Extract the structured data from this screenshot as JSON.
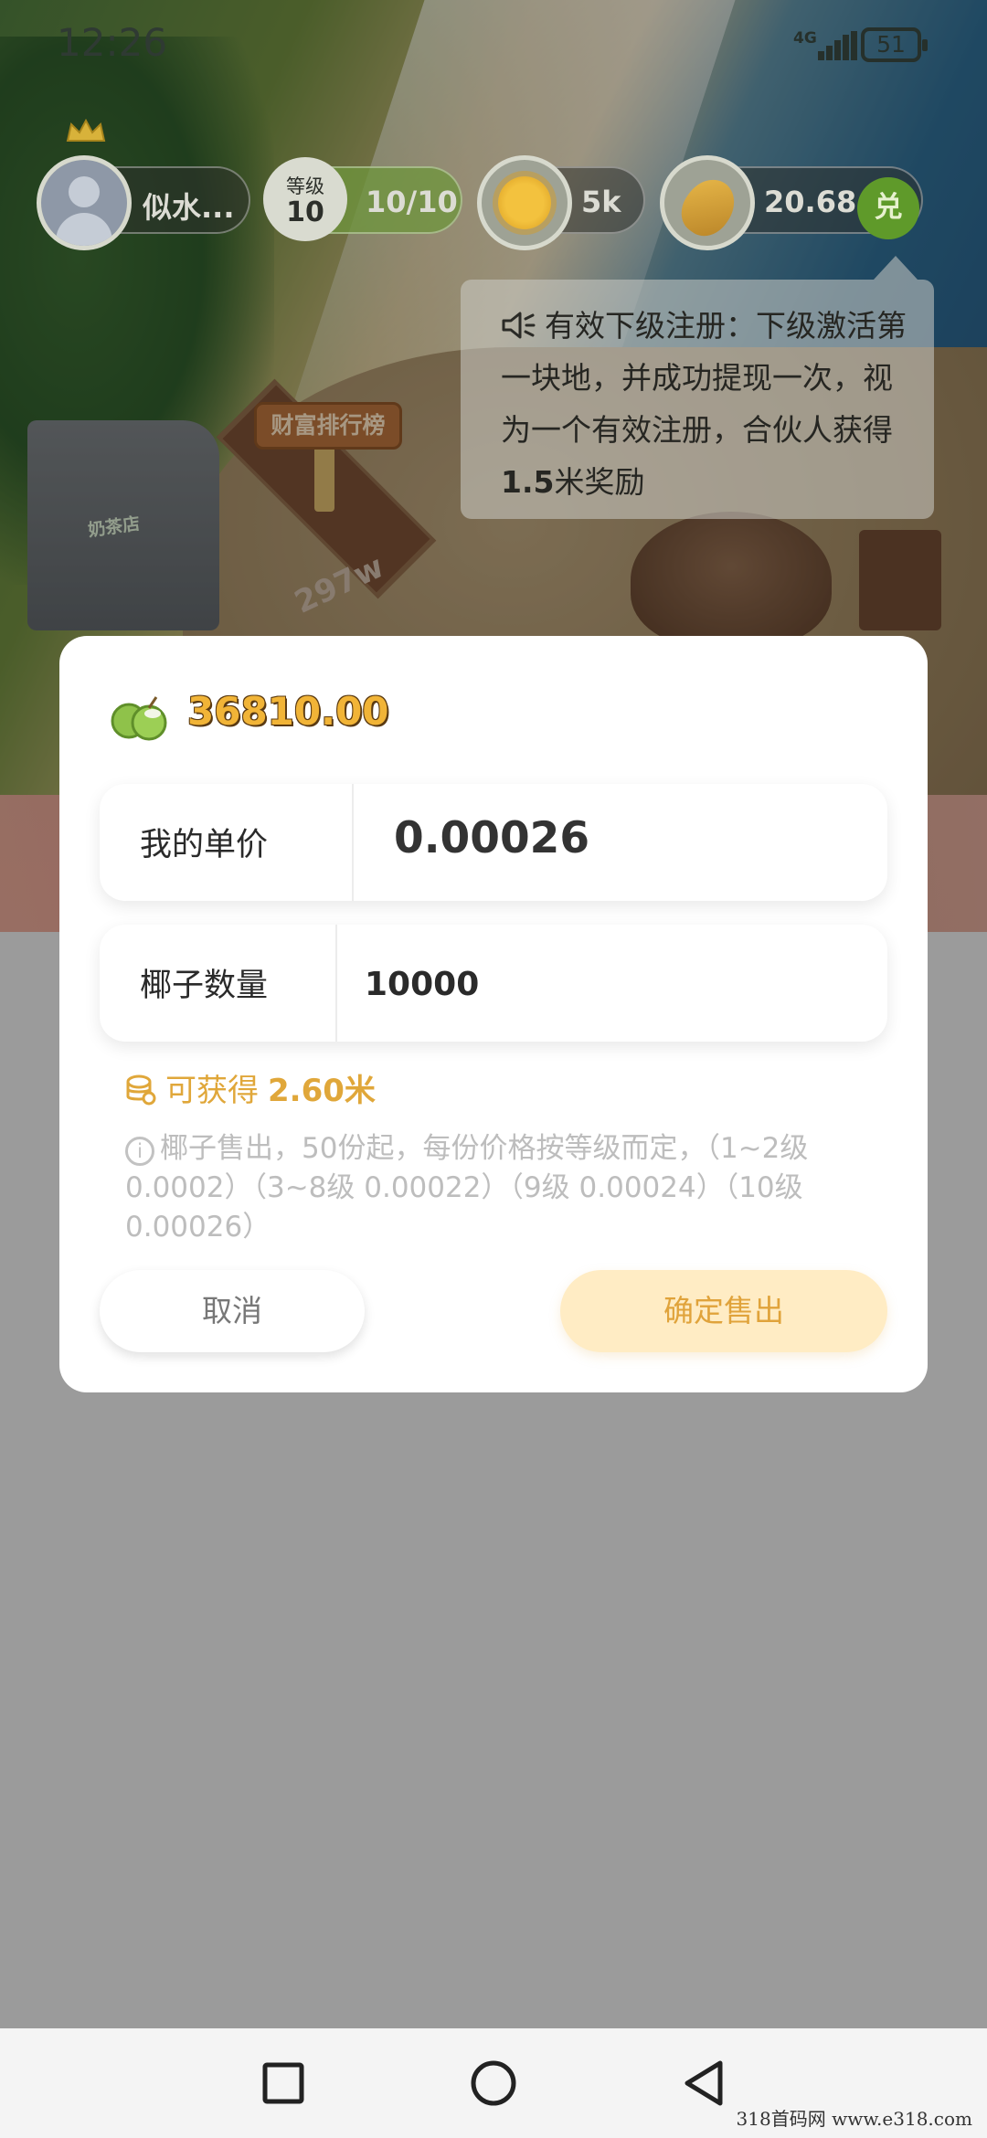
{
  "status_bar": {
    "time": "12:26",
    "network": "4G",
    "battery": "51"
  },
  "hud": {
    "username": "似水...",
    "level_label": "等级",
    "level_value": "10",
    "level_progress": "10/10",
    "sun_count": "5k",
    "corn_amount": "20.68",
    "exchange_label": "兑"
  },
  "game_scene": {
    "rank_sign": "财富排行榜",
    "building_label": "奶茶店",
    "path_label": "297w"
  },
  "notice": {
    "icon": "speaker-icon",
    "text_before": "有效下级注册：下级激活第一块地，并成功提现一次，视为一个有效注册，合伙人获得",
    "text_bold": "1.5",
    "text_after": "米奖励"
  },
  "dialog": {
    "coin_amount": "36810.00",
    "price_label": "我的单价",
    "price_value": "0.00026",
    "quantity_label": "椰子数量",
    "quantity_value": "10000",
    "earn_prefix": "可获得",
    "earn_amount": "2.60米",
    "rules_line": "椰子售出，50份起，每份价格按等级而定，（1~2级 0.0002）（3~8级 0.00022）（9级 0.00024）（10级0.00026）",
    "cancel_label": "取消",
    "confirm_label": "确定售出"
  },
  "nav": {
    "icons": [
      "square-icon",
      "circle-icon",
      "back-triangle-icon"
    ]
  },
  "watermark": "318首码网  www.e318.com",
  "colors": {
    "accent": "#f1b437",
    "earn": "#e0a73a",
    "confirm_bg": "#ffecc4",
    "exchange_green": "#5f9a2a"
  }
}
